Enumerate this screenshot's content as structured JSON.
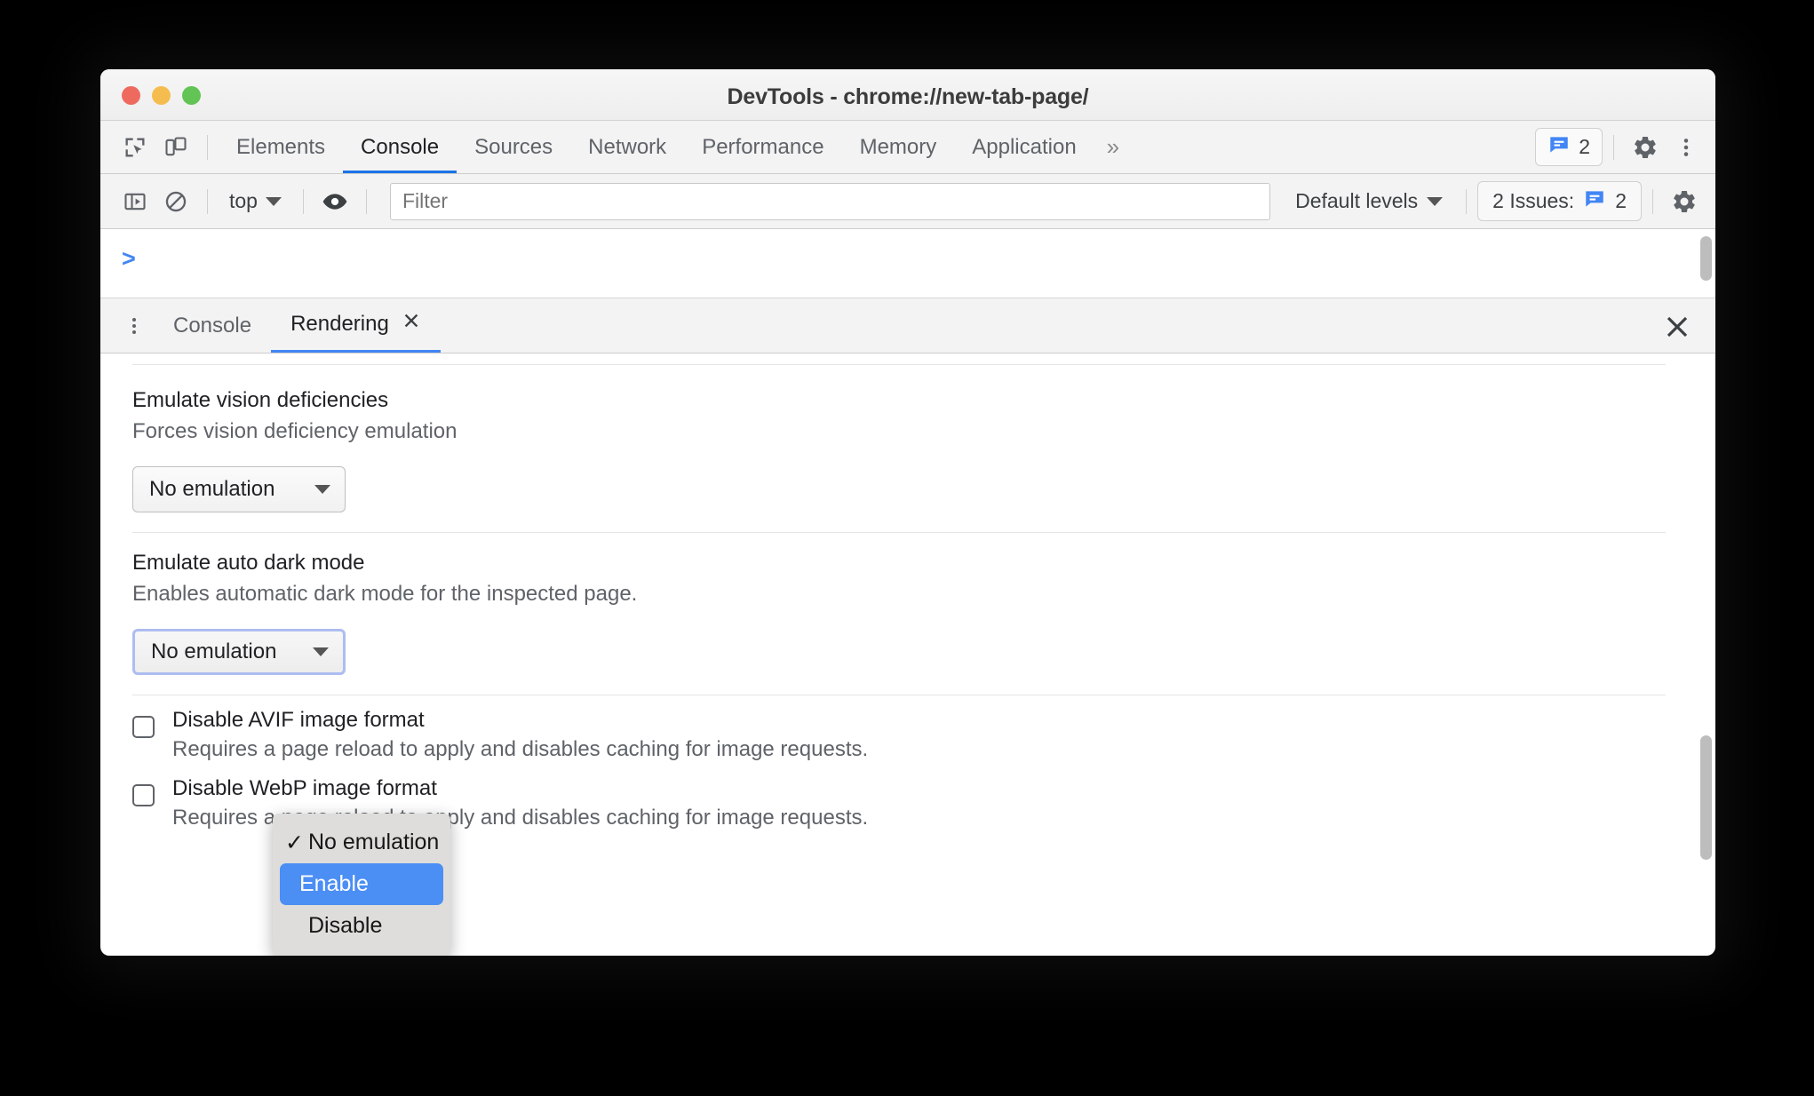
{
  "window": {
    "title": "DevTools - chrome://new-tab-page/",
    "traffic_lights": [
      "close",
      "minimize",
      "zoom"
    ],
    "colors": {
      "accent_blue": "#4285f4",
      "tab_active": "#1a73e8",
      "menu_highlight": "#4b8ef4"
    }
  },
  "main_toolbar": {
    "inspect_icon": "inspect-cursor-icon",
    "device_icon": "device-toolbar-icon",
    "tabs": [
      {
        "label": "Elements",
        "active": false
      },
      {
        "label": "Console",
        "active": true
      },
      {
        "label": "Sources",
        "active": false
      },
      {
        "label": "Network",
        "active": false
      },
      {
        "label": "Performance",
        "active": false
      },
      {
        "label": "Memory",
        "active": false
      },
      {
        "label": "Application",
        "active": false
      }
    ],
    "more_tabs": "»",
    "issues_count": "2",
    "settings_icon": "gear-icon",
    "more_icon": "kebab-menu-icon"
  },
  "console_toolbar": {
    "sidebar_icon": "console-sidebar-icon",
    "clear_icon": "clear-console-icon",
    "context": "top",
    "eye_icon": "live-expression-eye-icon",
    "filter_placeholder": "Filter",
    "filter_value": "",
    "levels": "Default levels",
    "issues_label": "2 Issues:",
    "issues_value": "2",
    "settings_icon": "console-settings-gear-icon"
  },
  "console_output": {
    "prompt": ">"
  },
  "drawer": {
    "kebab_icon": "drawer-more-icon",
    "tabs": [
      {
        "label": "Console",
        "active": false,
        "closable": false
      },
      {
        "label": "Rendering",
        "active": true,
        "closable": true
      }
    ],
    "close_icon": "close-drawer-icon"
  },
  "rendering": {
    "sections": [
      {
        "title": "Emulate vision deficiencies",
        "description": "Forces vision deficiency emulation",
        "select_value": "No emulation",
        "focused": false
      },
      {
        "title": "Emulate auto dark mode",
        "description": "Enables automatic dark mode for the inspected page.",
        "select_value": "No emulation",
        "focused": true
      }
    ],
    "checkboxes": [
      {
        "title": "Disable AVIF image format",
        "description": "Requires a page reload to apply and disables caching for image requests.",
        "checked": false
      },
      {
        "title": "Disable WebP image format",
        "description": "Requires a page reload to apply and disables caching for image requests.",
        "checked": false
      }
    ]
  },
  "dropdown_menu": {
    "open": true,
    "items": [
      {
        "label": "No emulation",
        "checked": true,
        "highlighted": false
      },
      {
        "label": "Enable",
        "checked": false,
        "highlighted": true
      },
      {
        "label": "Disable",
        "checked": false,
        "highlighted": false
      }
    ]
  }
}
